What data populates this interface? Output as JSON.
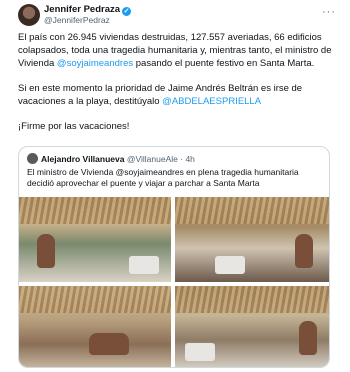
{
  "tweet": {
    "author_name": "Jennifer Pedraza",
    "author_handle": "@JenniferPedraz",
    "verified_icon": "verified-badge-icon",
    "more_icon": "···",
    "paragraph1_a": "El país con 26.945 viviendas destruidas, 127.557 averiadas, 66 edificios colapsados, toda una tragedia humanitaria y, mientras tanto, el ministro de Vivienda ",
    "paragraph1_mention": "@soyjaimeandres",
    "paragraph1_b": " pasando el puente festivo en Santa Marta.",
    "paragraph2_a": "Si en este momento la prioridad de Jaime Andrés Beltrán es irse de vacaciones a la playa, destitúyalo ",
    "paragraph2_mention": "@ABDELAESPRIELLA",
    "paragraph3": "¡Firme por las vacaciones!"
  },
  "quote": {
    "author_name": "Alejandro Villanueva",
    "author_handle": "@VillanueAle",
    "separator": "·",
    "time": "4h",
    "text": "El ministro de Vivienda @soyjaimeandres en plena tragedia humanitaria decidió aprovechar el puente y viajar a parchar a Santa Marta"
  }
}
